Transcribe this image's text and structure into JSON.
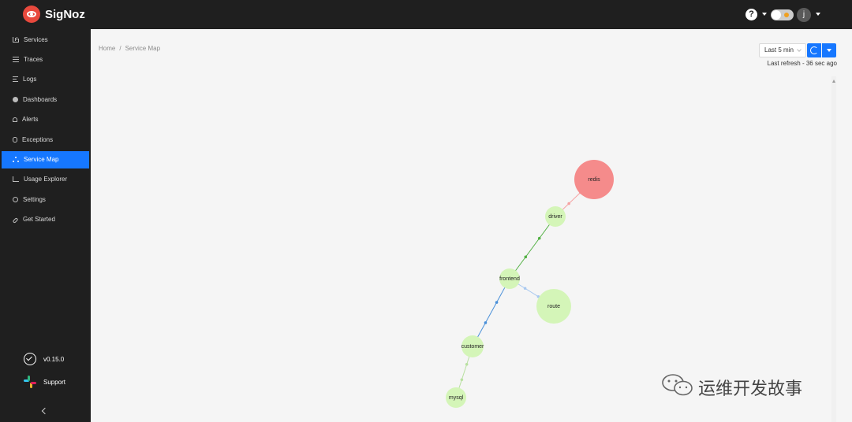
{
  "header": {
    "brand": "SigNoz",
    "help_icon": "question-circle-icon",
    "user_initial": "j"
  },
  "sidebar": {
    "items": [
      {
        "label": "Services",
        "icon": "bar-chart-icon"
      },
      {
        "label": "Traces",
        "icon": "menu-icon"
      },
      {
        "label": "Logs",
        "icon": "align-left-icon"
      },
      {
        "label": "Dashboards",
        "icon": "dashboard-icon"
      },
      {
        "label": "Alerts",
        "icon": "alert-icon"
      },
      {
        "label": "Exceptions",
        "icon": "bug-icon"
      },
      {
        "label": "Service Map",
        "icon": "deployment-unit-icon",
        "active": true
      },
      {
        "label": "Usage Explorer",
        "icon": "line-chart-icon"
      },
      {
        "label": "Settings",
        "icon": "setting-icon"
      },
      {
        "label": "Get Started",
        "icon": "api-icon"
      }
    ],
    "version": "v0.15.0",
    "support": "Support"
  },
  "main": {
    "breadcrumb": {
      "home": "Home",
      "separator": "/",
      "current": "Service Map"
    },
    "time_range": "Last 5 min",
    "last_refresh": "Last refresh - 36 sec ago"
  },
  "service_map": {
    "nodes": [
      {
        "id": "redis",
        "label": "redis",
        "status": "error",
        "color": "#f58b8b"
      },
      {
        "id": "driver",
        "label": "driver",
        "status": "ok",
        "color": "#d4f5b8"
      },
      {
        "id": "frontend",
        "label": "frontend",
        "status": "ok",
        "color": "#d4f5b8"
      },
      {
        "id": "route",
        "label": "route",
        "status": "ok",
        "color": "#d4f5b8"
      },
      {
        "id": "customer",
        "label": "customer",
        "status": "ok",
        "color": "#d4f5b8"
      },
      {
        "id": "mysql",
        "label": "mysql",
        "status": "ok",
        "color": "#d4f5b8"
      }
    ],
    "edges": [
      {
        "source": "driver",
        "target": "redis",
        "color": "#f5a3a3"
      },
      {
        "source": "frontend",
        "target": "driver",
        "color": "#52b043"
      },
      {
        "source": "frontend",
        "target": "route",
        "color": "#a8c8f0"
      },
      {
        "source": "frontend",
        "target": "customer",
        "color": "#4a90d9"
      },
      {
        "source": "customer",
        "target": "mysql",
        "color": "#b8e0a0"
      }
    ]
  },
  "watermark": "运维开发故事",
  "colors": {
    "accent": "#1677ff",
    "sidebar_bg": "#1f1f1f",
    "brand_red": "#e8493d"
  }
}
